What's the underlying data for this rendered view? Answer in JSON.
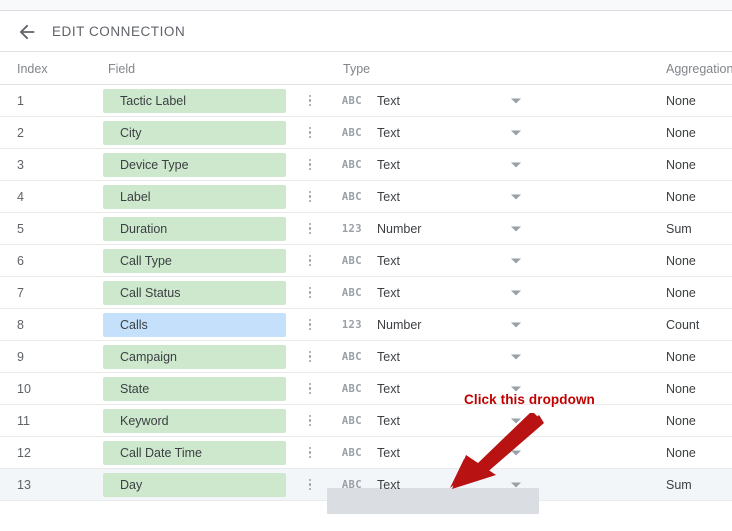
{
  "header": {
    "title": "EDIT CONNECTION",
    "back_icon": "arrow-left-icon"
  },
  "table": {
    "columns": {
      "index": "Index",
      "field": "Field",
      "type": "Type",
      "aggregation": "Aggregation"
    },
    "rows": [
      {
        "index": "1",
        "field": "Tactic Label",
        "kind": "dimension",
        "type_icon": "ABC",
        "type": "Text",
        "aggregation": "None",
        "agg_has_caret": false,
        "selected": false,
        "highlighted_type": false
      },
      {
        "index": "2",
        "field": "City",
        "kind": "dimension",
        "type_icon": "ABC",
        "type": "Text",
        "aggregation": "None",
        "agg_has_caret": false,
        "selected": false,
        "highlighted_type": false
      },
      {
        "index": "3",
        "field": "Device Type",
        "kind": "dimension",
        "type_icon": "ABC",
        "type": "Text",
        "aggregation": "None",
        "agg_has_caret": false,
        "selected": false,
        "highlighted_type": false
      },
      {
        "index": "4",
        "field": "Label",
        "kind": "dimension",
        "type_icon": "ABC",
        "type": "Text",
        "aggregation": "None",
        "agg_has_caret": false,
        "selected": false,
        "highlighted_type": false
      },
      {
        "index": "5",
        "field": "Duration",
        "kind": "dimension",
        "type_icon": "123",
        "type": "Number",
        "aggregation": "Sum",
        "agg_has_caret": true,
        "selected": false,
        "highlighted_type": false
      },
      {
        "index": "6",
        "field": "Call Type",
        "kind": "dimension",
        "type_icon": "ABC",
        "type": "Text",
        "aggregation": "None",
        "agg_has_caret": false,
        "selected": false,
        "highlighted_type": false
      },
      {
        "index": "7",
        "field": "Call Status",
        "kind": "dimension",
        "type_icon": "ABC",
        "type": "Text",
        "aggregation": "None",
        "agg_has_caret": false,
        "selected": false,
        "highlighted_type": false
      },
      {
        "index": "8",
        "field": "Calls",
        "kind": "metric",
        "type_icon": "123",
        "type": "Number",
        "aggregation": "Count",
        "agg_has_caret": true,
        "selected": false,
        "highlighted_type": false
      },
      {
        "index": "9",
        "field": "Campaign",
        "kind": "dimension",
        "type_icon": "ABC",
        "type": "Text",
        "aggregation": "None",
        "agg_has_caret": false,
        "selected": false,
        "highlighted_type": false
      },
      {
        "index": "10",
        "field": "State",
        "kind": "dimension",
        "type_icon": "ABC",
        "type": "Text",
        "aggregation": "None",
        "agg_has_caret": false,
        "selected": false,
        "highlighted_type": false
      },
      {
        "index": "11",
        "field": "Keyword",
        "kind": "dimension",
        "type_icon": "ABC",
        "type": "Text",
        "aggregation": "None",
        "agg_has_caret": false,
        "selected": false,
        "highlighted_type": false
      },
      {
        "index": "12",
        "field": "Call Date Time",
        "kind": "dimension",
        "type_icon": "ABC",
        "type": "Text",
        "aggregation": "None",
        "agg_has_caret": false,
        "selected": false,
        "highlighted_type": false
      },
      {
        "index": "13",
        "field": "Day",
        "kind": "dimension",
        "type_icon": "ABC",
        "type": "Text",
        "aggregation": "Sum",
        "agg_has_caret": false,
        "selected": true,
        "highlighted_type": true
      }
    ]
  },
  "annotation": {
    "text": "Click this dropdown",
    "color": "#c00000",
    "arrow_color": "#b81212"
  },
  "colors": {
    "dimension_chip": "#cde8cd",
    "metric_chip": "#c5e0fb",
    "selected_row": "#f2f6f9",
    "highlight_box": "#dadde1",
    "text": "#3c4043",
    "muted_text": "#80868b"
  }
}
